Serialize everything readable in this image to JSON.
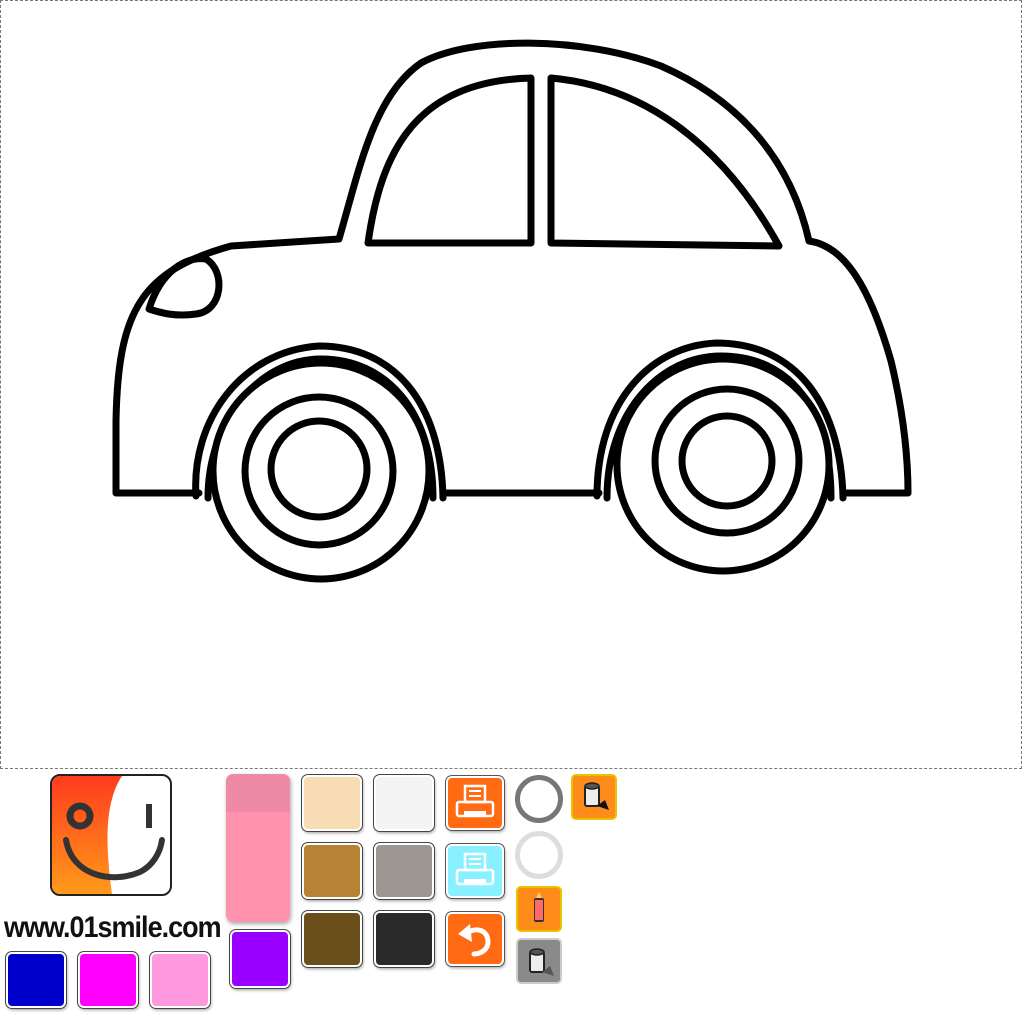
{
  "branding": {
    "site_url": "www.01smile.com"
  },
  "palette": {
    "left_row": [
      {
        "name": "blue",
        "color": "#0000cc"
      },
      {
        "name": "magenta",
        "color": "#ff00ff"
      },
      {
        "name": "pink",
        "color": "#ff99dd"
      }
    ],
    "purple": {
      "name": "purple",
      "color": "#9900ff"
    },
    "grid": [
      {
        "name": "peach",
        "color": "#f7dcb4"
      },
      {
        "name": "white",
        "color": "#f4f4f4"
      },
      {
        "name": "tan",
        "color": "#b88234"
      },
      {
        "name": "gray",
        "color": "#9c9793"
      },
      {
        "name": "brown",
        "color": "#6b4f1b"
      },
      {
        "name": "black",
        "color": "#2a2a2a"
      }
    ]
  },
  "tools": {
    "eraser_color": "#ff93ae",
    "print_color": "#ff6a13",
    "print_light_color": "#88f0ff",
    "undo_color": "#ff6a13",
    "accent_orange": "#ff8c1a"
  }
}
